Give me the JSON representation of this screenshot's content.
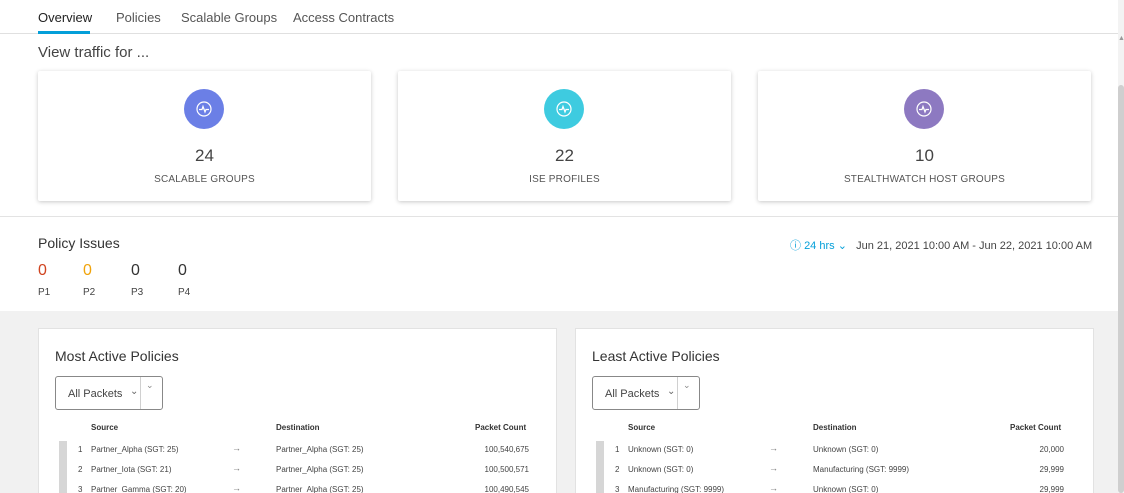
{
  "tabs": [
    {
      "label": "Overview",
      "active": true
    },
    {
      "label": "Policies",
      "active": false
    },
    {
      "label": "Scalable Groups",
      "active": false
    },
    {
      "label": "Access Contracts",
      "active": false
    }
  ],
  "view_traffic_label": "View traffic for ...",
  "cards": [
    {
      "count": "24",
      "label": "SCALABLE GROUPS",
      "icon": "activity-icon",
      "color": "#6b7fe6"
    },
    {
      "count": "22",
      "label": "ISE PROFILES",
      "icon": "activity-icon",
      "color": "#3ecbe0"
    },
    {
      "count": "10",
      "label": "STEALTHWATCH HOST GROUPS",
      "icon": "activity-icon",
      "color": "#8d79c1"
    }
  ],
  "policy_issues": {
    "title": "Policy Issues",
    "priorities": [
      {
        "count": "0",
        "label": "P1",
        "color": "#d0431f"
      },
      {
        "count": "0",
        "label": "P2",
        "color": "#f0a30a"
      },
      {
        "count": "0",
        "label": "P3",
        "color": "#333333"
      },
      {
        "count": "0",
        "label": "P4",
        "color": "#333333"
      }
    ]
  },
  "time_range": {
    "period": "24 hrs",
    "range": "Jun 21, 2021 10:00 AM - Jun 22, 2021 10:00 AM"
  },
  "most_active": {
    "title": "Most Active Policies",
    "filter": "All Packets",
    "headers": {
      "source": "Source",
      "destination": "Destination",
      "count": "Packet Count"
    },
    "rows": [
      {
        "index": "1",
        "source": "Partner_Alpha (SGT: 25)",
        "destination": "Partner_Alpha (SGT: 25)",
        "count": "100,540,675"
      },
      {
        "index": "2",
        "source": "Partner_Iota (SGT: 21)",
        "destination": "Partner_Alpha (SGT: 25)",
        "count": "100,500,571"
      },
      {
        "index": "3",
        "source": "Partner_Gamma (SGT: 20)",
        "destination": "Partner_Alpha (SGT: 25)",
        "count": "100,490,545"
      }
    ]
  },
  "least_active": {
    "title": "Least Active Policies",
    "filter": "All Packets",
    "headers": {
      "source": "Source",
      "destination": "Destination",
      "count": "Packet Count"
    },
    "rows": [
      {
        "index": "1",
        "source": "Unknown (SGT: 0)",
        "destination": "Unknown (SGT: 0)",
        "count": "20,000"
      },
      {
        "index": "2",
        "source": "Unknown (SGT: 0)",
        "destination": "Manufacturing (SGT: 9999)",
        "count": "29,999"
      },
      {
        "index": "3",
        "source": "Manufacturing (SGT: 9999)",
        "destination": "Unknown (SGT: 0)",
        "count": "29,999"
      }
    ]
  }
}
